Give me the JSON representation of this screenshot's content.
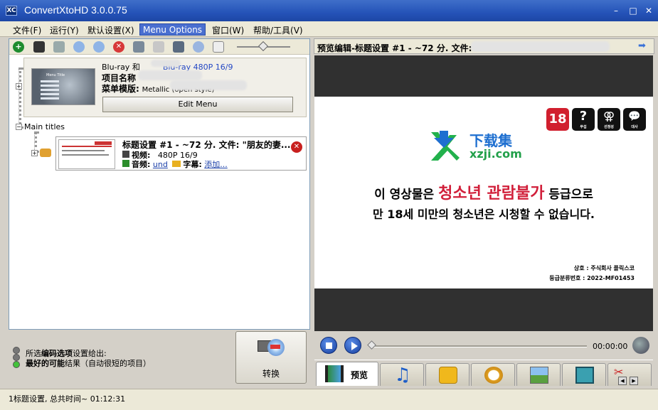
{
  "window": {
    "title": "ConvertXtoHD 3.0.0.75",
    "icon": "XC"
  },
  "menu": [
    "文件(F)",
    "运行(Y)",
    "默认设置(X)",
    "Menu Options",
    "窗口(W)",
    "帮助/工具(V)"
  ],
  "project": {
    "line1_prefix": "Blu-ray 和",
    "line1_link": "Blu-ray 480P 16/9",
    "line2": "项目名称",
    "line3_label": "菜单模版:",
    "line3_value": "Metallic (open style)",
    "edit_menu": "Edit Menu",
    "thumb_title": "Menu Title"
  },
  "tree": {
    "main_titles": "Main titles"
  },
  "title_item": {
    "line1": "标题设置 #1 - ~72 分. 文件: \"朋友的妻...",
    "video_label": "视频:",
    "video_value": "480P 16/9",
    "audio_label": "音频:",
    "audio_value": "und",
    "subtitle_label": "字幕:",
    "subtitle_value": "添加..."
  },
  "status_msg": {
    "line1_a": "所选",
    "line1_b": "编码选项",
    "line1_c": "设置给出:",
    "line2_a": "最好的可能",
    "line2_b": "结果（自动很短的项目）"
  },
  "convert": {
    "label": "转换"
  },
  "statusbar": {
    "text": "1标题设置, 总共时间~ 01:12:31"
  },
  "preview": {
    "header": "预览编辑-标题设置 #1 - ~72 分. 文件:",
    "ratings": [
      "18",
      "?",
      "⚢",
      "💬"
    ],
    "rating_captions": [
      "",
      "무섭",
      "선정성",
      "대사"
    ],
    "logo_cn": "下载集",
    "logo_en": "xzji.com",
    "kr_line1_a": "이 영상물은 ",
    "kr_line1_b": "청소년 관람불가",
    "kr_line1_c": " 등급으로",
    "kr_line2": "만 18세 미만의 청소년은 시청할 수 없습니다.",
    "corp_line1": "상호 : 주식회사 플릭스코",
    "corp_line2": "등급분류번호 : 2022-MF01453",
    "time": "00:00:00"
  },
  "tabs": [
    {
      "label": "预览",
      "icon": "film-icon"
    },
    {
      "icon": "music-icon"
    },
    {
      "icon": "subtitle-icon"
    },
    {
      "icon": "stopwatch-icon"
    },
    {
      "icon": "image-icon"
    },
    {
      "icon": "crop-icon"
    },
    {
      "icon": "cut-icon"
    }
  ],
  "colors": {
    "accent": "#2553b8",
    "rating_red": "#d11f2e",
    "kr_red": "#d11f3a",
    "logo_blue": "#1e6fd0"
  }
}
